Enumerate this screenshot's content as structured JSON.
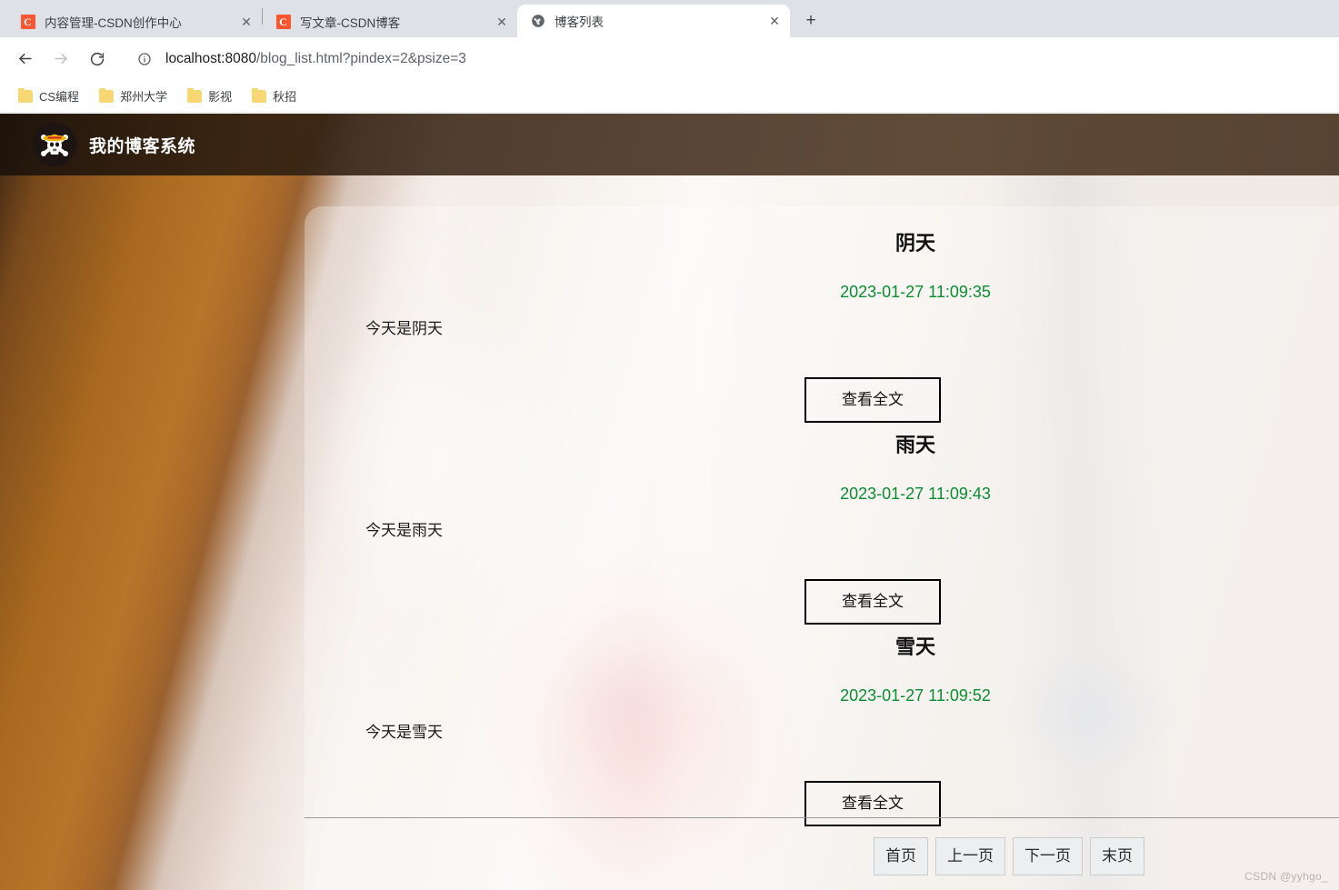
{
  "browser": {
    "tabs": [
      {
        "title": "内容管理-CSDN创作中心",
        "favicon": "csdn-icon",
        "active": false,
        "close_label": "✕"
      },
      {
        "title": "写文章-CSDN博客",
        "favicon": "csdn-icon",
        "active": false,
        "close_label": "✕"
      },
      {
        "title": "博客列表",
        "favicon": "globe-icon",
        "active": true,
        "close_label": "✕"
      }
    ],
    "new_tab_label": "+",
    "nav": {
      "back_label": "←",
      "forward_label": "→",
      "reload_label": "⟳"
    },
    "omnibox": {
      "url_host": "localhost:8080",
      "url_rest": "/blog_list.html?pindex=2&psize=3",
      "full_url": "localhost:8080/blog_list.html?pindex=2&psize=3",
      "security_icon": "info-circle-icon"
    },
    "bookmarks": [
      {
        "label": "CS编程",
        "icon": "folder-icon"
      },
      {
        "label": "郑州大学",
        "icon": "folder-icon"
      },
      {
        "label": "影视",
        "icon": "folder-icon"
      },
      {
        "label": "秋招",
        "icon": "folder-icon"
      }
    ]
  },
  "site": {
    "logo_icon": "skull-crossbones-straw-hat-icon",
    "title": "我的博客系统"
  },
  "blog_list": {
    "posts": [
      {
        "title": "阴天",
        "date": "2023-01-27 11:09:35",
        "desc": "今天是阴天",
        "readmore_label": "查看全文"
      },
      {
        "title": "雨天",
        "date": "2023-01-27 11:09:43",
        "desc": "今天是雨天",
        "readmore_label": "查看全文"
      },
      {
        "title": "雪天",
        "date": "2023-01-27 11:09:52",
        "desc": "今天是雪天",
        "readmore_label": "查看全文"
      }
    ]
  },
  "pagination": {
    "buttons": [
      {
        "label": "首页"
      },
      {
        "label": "上一页"
      },
      {
        "label": "下一页"
      },
      {
        "label": "末页"
      }
    ]
  },
  "watermark": "CSDN @yyhgo_",
  "colors": {
    "date_green": "#0a8f33",
    "header_dark": "#2a1c10",
    "csdn_red": "#fc5531",
    "folder_yellow": "#f7d774"
  }
}
